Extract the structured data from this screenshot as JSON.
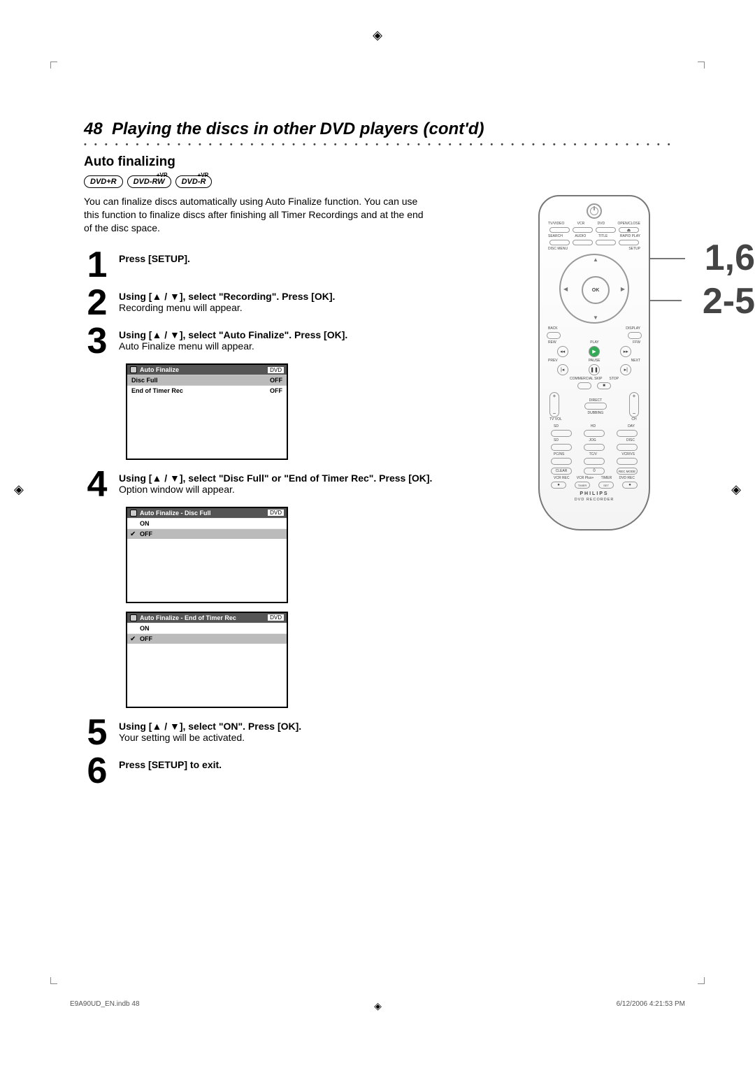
{
  "registration_mark": "◈",
  "page_number": "48",
  "title": "Playing the discs in other DVD players (cont'd)",
  "section": "Auto finalizing",
  "badges": [
    "DVD+R",
    "DVD-RW",
    "DVD-R"
  ],
  "badge_vr": "+VR",
  "intro": "You can finalize discs automatically using Auto Finalize function. You can use this function to finalize discs after finishing all Timer Recordings and at the end of the disc space.",
  "steps": {
    "s1": {
      "num": "1",
      "bold": "Press [SETUP]."
    },
    "s2": {
      "num": "2",
      "bold": "Using [▲ / ▼], select \"Recording\". Press [OK].",
      "sub": "Recording menu will appear."
    },
    "s3": {
      "num": "3",
      "bold": "Using [▲ / ▼], select \"Auto Finalize\". Press [OK].",
      "sub": "Auto Finalize menu will appear."
    },
    "s4": {
      "num": "4",
      "bold": "Using [▲ / ▼], select \"Disc Full\" or \"End of Timer Rec\". Press [OK].",
      "sub": "Option window will appear."
    },
    "s5": {
      "num": "5",
      "bold": "Using [▲ / ▼], select \"ON\". Press [OK].",
      "sub": "Your setting will be activated."
    },
    "s6": {
      "num": "6",
      "bold": "Press [SETUP] to exit."
    }
  },
  "osd1": {
    "title": "Auto Finalize",
    "tag": "DVD",
    "rows": [
      [
        "Disc Full",
        "OFF"
      ],
      [
        "End of Timer Rec",
        "OFF"
      ]
    ]
  },
  "osd2": {
    "title": "Auto Finalize - Disc Full",
    "tag": "DVD",
    "opts": [
      "ON",
      "OFF"
    ],
    "selected": "OFF"
  },
  "osd3": {
    "title": "Auto Finalize - End of Timer Rec",
    "tag": "DVD",
    "opts": [
      "ON",
      "OFF"
    ],
    "selected": "OFF"
  },
  "remote": {
    "row1": [
      "TV/VIDEO",
      "VCR",
      "DVD",
      "OPEN/CLOSE"
    ],
    "eject": "⏏",
    "row2": [
      "SEARCH",
      "AUDIO",
      "TITLE",
      "RAPID PLAY"
    ],
    "disc_menu": "DISC MENU",
    "setup": "SETUP",
    "ok": "OK",
    "back": "BACK",
    "display": "DISPLAY",
    "mid": [
      "REW",
      "PLAY",
      "FFW"
    ],
    "mid2": [
      "PREV",
      "PAUSE",
      "NEXT"
    ],
    "skip_lbl": "COMMERCIAL SKIP",
    "stop": "STOP",
    "tv_vol": "TV VOL",
    "direct": "DIRECT",
    "dubbing": "DUBBING",
    "ch": "CH",
    "kp_lbls": [
      [
        "SD",
        "HD",
        "DAY"
      ],
      [
        "SD",
        "JOG",
        "DISC"
      ],
      [
        "PC/NS",
        "TC/V",
        "VCR/VS"
      ]
    ],
    "bot_btns": [
      "CLEAR",
      "0",
      "REC MODE"
    ],
    "bot_btns2_lbl": [
      "VCR REC",
      "VCR Plus+",
      "TIMER",
      "DVD REC"
    ],
    "bot_btns2": [
      "●",
      "TIMER",
      "SET",
      "●"
    ],
    "brand": "PHILIPS",
    "type": "DVD RECORDER"
  },
  "callouts": {
    "c1": "1,6",
    "c2": "2-5"
  },
  "footer": {
    "left": "E9A90UD_EN.indb   48",
    "right": "6/12/2006   4:21:53 PM"
  }
}
